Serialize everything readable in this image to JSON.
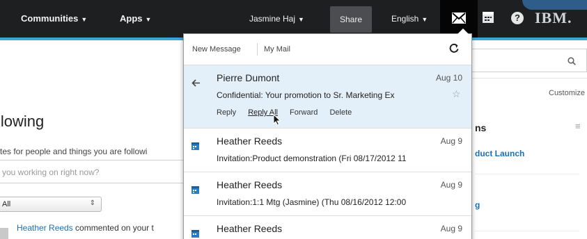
{
  "nav": {
    "communities_label": "Communities",
    "apps_label": "Apps",
    "user_label": "Jasmine Haj",
    "share_label": "Share",
    "language_label": "English",
    "brand": "IBM."
  },
  "colors": {
    "topbar_bg": "#1d1f21",
    "accent": "#3aa3d8",
    "link": "#1a6fb5",
    "selected_row": "#e3f0fa"
  },
  "icons": [
    "mail-icon",
    "calendar-icon",
    "help-icon",
    "search-icon",
    "refresh-icon",
    "back-arrow-icon",
    "star-icon"
  ],
  "page": {
    "title": "llowing",
    "description": "tes for people and things you are followi",
    "status_placeholder": "you working on right now?",
    "filter_value": "All",
    "activity_name": "Heather Reeds",
    "activity_text": " commented on your t"
  },
  "right_panel": {
    "customize_label": "Customize",
    "title": "ns",
    "link1": "duct Launch",
    "link2": "g"
  },
  "mail_popup": {
    "new_message_label": "New Message",
    "my_mail_label": "My Mail",
    "messages": [
      {
        "sender": "Pierre Dumont",
        "date": "Aug 10",
        "subject": "Confidential: Your promotion to Sr. Marketing Ex",
        "actions": [
          "Reply",
          "Reply All",
          "Forward",
          "Delete"
        ]
      },
      {
        "sender": "Heather Reeds",
        "date": "Aug 9",
        "subject": "Invitation:Product demonstration (Fri 08/17/2012 11"
      },
      {
        "sender": "Heather Reeds",
        "date": "Aug 9",
        "subject": "Invitation:1:1 Mtg (Jasmine) (Thu 08/16/2012 12:00"
      },
      {
        "sender": "Heather Reeds",
        "date": "Aug 9",
        "subject": ""
      }
    ]
  }
}
